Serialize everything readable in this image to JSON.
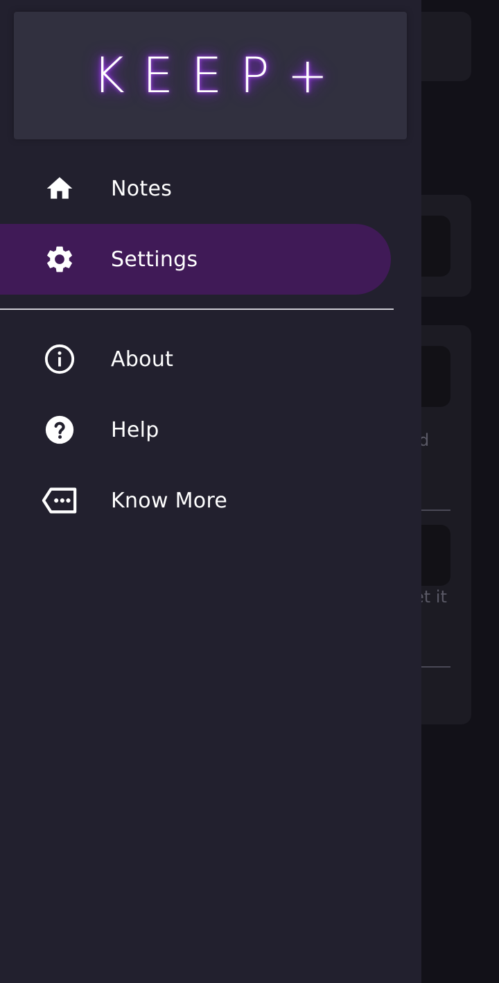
{
  "app": {
    "logo_text": "KEEP+"
  },
  "drawer": {
    "primary_items": [
      {
        "label": "Notes",
        "icon": "home-icon",
        "active": false
      },
      {
        "label": "Settings",
        "icon": "gear-icon",
        "active": true
      }
    ],
    "secondary_items": [
      {
        "label": "About",
        "icon": "info-icon"
      },
      {
        "label": "Help",
        "icon": "help-icon"
      },
      {
        "label": "Know More",
        "icon": "more-tag-icon"
      }
    ]
  },
  "background": {
    "partial_texts": [
      "d",
      "et it"
    ]
  },
  "colors": {
    "drawer_bg": "#22202e",
    "active_item_bg": "#401a57",
    "logo_glow": "#8a2be2"
  }
}
